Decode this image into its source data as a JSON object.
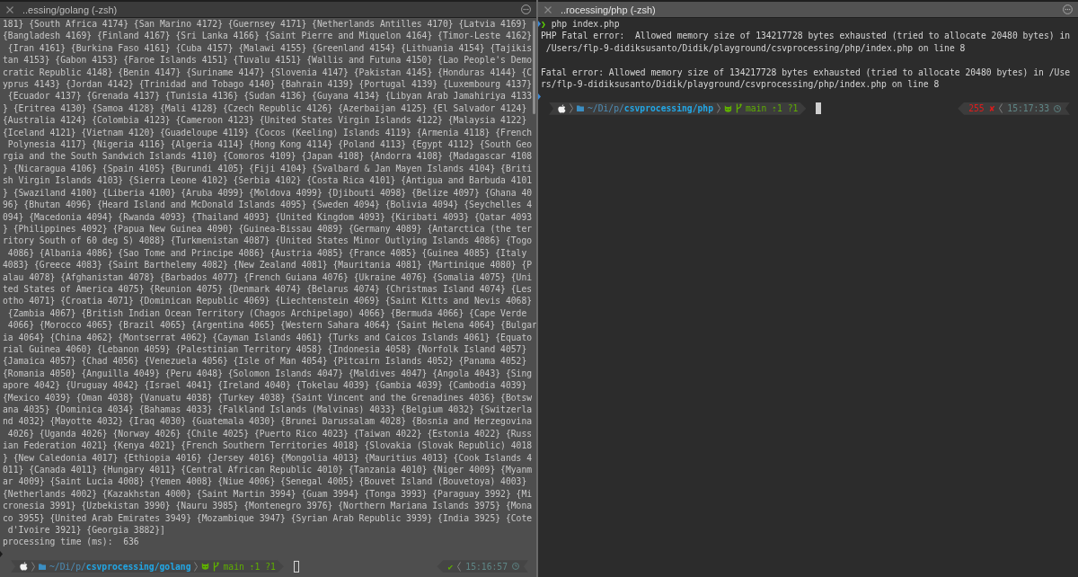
{
  "panes": [
    {
      "title": "..essing/golang (-zsh)",
      "active": false,
      "lines": [
        {
          "kind": "text",
          "text": "181} {South Africa 4174} {San Marino 4172} {Guernsey 4171} {Netherlands Antilles 4170} {Latvia 4169}"
        },
        {
          "kind": "text",
          "text": "{Bangladesh 4169} {Finland 4167} {Sri Lanka 4166} {Saint Pierre and Miquelon 4164} {Timor-Leste 4162}"
        },
        {
          "kind": "text",
          "text": " {Iran 4161} {Burkina Faso 4161} {Cuba 4157} {Malawi 4155} {Greenland 4154} {Lithuania 4154} {Tajikis"
        },
        {
          "kind": "text",
          "text": "tan 4153} {Gabon 4153} {Faroe Islands 4151} {Tuvalu 4151} {Wallis and Futuna 4150} {Lao People's Demo"
        },
        {
          "kind": "text",
          "text": "cratic Republic 4148} {Benin 4147} {Suriname 4147} {Slovenia 4147} {Pakistan 4145} {Honduras 4144} {C"
        },
        {
          "kind": "text",
          "text": "yprus 4143} {Jordan 4142} {Trinidad and Tobago 4140} {Bahrain 4139} {Portugal 4139} {Luxembourg 4137}"
        },
        {
          "kind": "text",
          "text": " {Ecuador 4137} {Grenada 4137} {Tunisia 4136} {Sudan 4136} {Guyana 4134} {Libyan Arab Jamahiriya 4133"
        },
        {
          "kind": "text",
          "text": "} {Eritrea 4130} {Samoa 4128} {Mali 4128} {Czech Republic 4126} {Azerbaijan 4125} {El Salvador 4124}"
        },
        {
          "kind": "text",
          "text": "{Australia 4124} {Colombia 4123} {Cameroon 4123} {United States Virgin Islands 4122} {Malaysia 4122}"
        },
        {
          "kind": "text",
          "text": "{Iceland 4121} {Vietnam 4120} {Guadeloupe 4119} {Cocos (Keeling) Islands 4119} {Armenia 4118} {French"
        },
        {
          "kind": "text",
          "text": " Polynesia 4117} {Nigeria 4116} {Algeria 4114} {Hong Kong 4114} {Poland 4113} {Egypt 4112} {South Geo"
        },
        {
          "kind": "text",
          "text": "rgia and the South Sandwich Islands 4110} {Comoros 4109} {Japan 4108} {Andorra 4108} {Madagascar 4108"
        },
        {
          "kind": "text",
          "text": "} {Nicaragua 4106} {Spain 4105} {Burundi 4105} {Fiji 4104} {Svalbard & Jan Mayen Islands 4104} {Briti"
        },
        {
          "kind": "text",
          "text": "sh Virgin Islands 4103} {Sierra Leone 4102} {Serbia 4102} {Costa Rica 4101} {Antigua and Barbuda 4101"
        },
        {
          "kind": "text",
          "text": "} {Swaziland 4100} {Liberia 4100} {Aruba 4099} {Moldova 4099} {Djibouti 4098} {Belize 4097} {Ghana 40"
        },
        {
          "kind": "text",
          "text": "96} {Bhutan 4096} {Heard Island and McDonald Islands 4095} {Sweden 4094} {Bolivia 4094} {Seychelles 4"
        },
        {
          "kind": "text",
          "text": "094} {Macedonia 4094} {Rwanda 4093} {Thailand 4093} {United Kingdom 4093} {Kiribati 4093} {Qatar 4093"
        },
        {
          "kind": "text",
          "text": "} {Philippines 4092} {Papua New Guinea 4090} {Guinea-Bissau 4089} {Germany 4089} {Antarctica (the ter"
        },
        {
          "kind": "text",
          "text": "ritory South of 60 deg S) 4088} {Turkmenistan 4087} {United States Minor Outlying Islands 4086} {Togo"
        },
        {
          "kind": "text",
          "text": " 4086} {Albania 4086} {Sao Tome and Principe 4086} {Austria 4085} {France 4085} {Guinea 4085} {Italy"
        },
        {
          "kind": "text",
          "text": "4083} {Greece 4083} {Saint Barthelemy 4082} {New Zealand 4081} {Mauritania 4081} {Martinique 4080} {P"
        },
        {
          "kind": "text",
          "text": "alau 4078} {Afghanistan 4078} {Barbados 4077} {French Guiana 4076} {Ukraine 4076} {Somalia 4075} {Uni"
        },
        {
          "kind": "text",
          "text": "ted States of America 4075} {Reunion 4075} {Denmark 4074} {Belarus 4074} {Christmas Island 4074} {Les"
        },
        {
          "kind": "text",
          "text": "otho 4071} {Croatia 4071} {Dominican Republic 4069} {Liechtenstein 4069} {Saint Kitts and Nevis 4068}"
        },
        {
          "kind": "text",
          "text": " {Zambia 4067} {British Indian Ocean Territory (Chagos Archipelago) 4066} {Bermuda 4066} {Cape Verde"
        },
        {
          "kind": "text",
          "text": " 4066} {Morocco 4065} {Brazil 4065} {Argentina 4065} {Western Sahara 4064} {Saint Helena 4064} {Bulgar"
        },
        {
          "kind": "text",
          "text": "ia 4064} {China 4062} {Montserrat 4062} {Cayman Islands 4061} {Turks and Caicos Islands 4061} {Equato"
        },
        {
          "kind": "text",
          "text": "rial Guinea 4060} {Lebanon 4059} {Palestinian Territory 4058} {Indonesia 4058} {Norfolk Island 4057}"
        },
        {
          "kind": "text",
          "text": "{Jamaica 4057} {Chad 4056} {Venezuela 4056} {Isle of Man 4054} {Pitcairn Islands 4052} {Panama 4052}"
        },
        {
          "kind": "text",
          "text": "{Romania 4050} {Anguilla 4049} {Peru 4048} {Solomon Islands 4047} {Maldives 4047} {Angola 4043} {Sing"
        },
        {
          "kind": "text",
          "text": "apore 4042} {Uruguay 4042} {Israel 4041} {Ireland 4040} {Tokelau 4039} {Gambia 4039} {Cambodia 4039}"
        },
        {
          "kind": "text",
          "text": "{Mexico 4039} {Oman 4038} {Vanuatu 4038} {Turkey 4038} {Saint Vincent and the Grenadines 4036} {Botsw"
        },
        {
          "kind": "text",
          "text": "ana 4035} {Dominica 4034} {Bahamas 4033} {Falkland Islands (Malvinas) 4033} {Belgium 4032} {Switzerla"
        },
        {
          "kind": "text",
          "text": "nd 4032} {Mayotte 4032} {Iraq 4030} {Guatemala 4030} {Brunei Darussalam 4028} {Bosnia and Herzegovina"
        },
        {
          "kind": "text",
          "text": " 4026} {Uganda 4026} {Norway 4026} {Chile 4025} {Puerto Rico 4023} {Taiwan 4022} {Estonia 4022} {Russ"
        },
        {
          "kind": "text",
          "text": "ian Federation 4021} {Kenya 4021} {French Southern Territories 4018} {Slovakia (Slovak Republic) 4018"
        },
        {
          "kind": "text",
          "text": "} {New Caledonia 4017} {Ethiopia 4016} {Jersey 4016} {Mongolia 4013} {Mauritius 4013} {Cook Islands 4"
        },
        {
          "kind": "text",
          "text": "011} {Canada 4011} {Hungary 4011} {Central African Republic 4010} {Tanzania 4010} {Niger 4009} {Myanm"
        },
        {
          "kind": "text",
          "text": "ar 4009} {Saint Lucia 4008} {Yemen 4008} {Niue 4006} {Senegal 4005} {Bouvet Island (Bouvetoya) 4003}"
        },
        {
          "kind": "text",
          "text": "{Netherlands 4002} {Kazakhstan 4000} {Saint Martin 3994} {Guam 3994} {Tonga 3993} {Paraguay 3992} {Mi"
        },
        {
          "kind": "text",
          "text": "cronesia 3991} {Uzbekistan 3990} {Nauru 3985} {Montenegro 3976} {Northern Mariana Islands 3975} {Mona"
        },
        {
          "kind": "text",
          "text": "co 3955} {United Arab Emirates 3949} {Mozambique 3947} {Syrian Arab Republic 3939} {India 3925} {Cote"
        },
        {
          "kind": "text",
          "text": " d'Ivoire 3921} {Georgia 3882}]"
        },
        {
          "kind": "text",
          "text": "processing time (ms):  636"
        },
        {
          "kind": "mark"
        }
      ],
      "prompt": {
        "path": "~/Di/p/**csvprocessing/golang**",
        "git_status": "main ⇡1 ?1",
        "exit_status": {
          "ok": true,
          "text": "✔"
        },
        "time": "15:16:57"
      }
    },
    {
      "title": "..rocessing/php (-zsh)",
      "active": true,
      "lines": [
        {
          "kind": "command",
          "prompt_symbol": "❯",
          "text": "php index.php"
        },
        {
          "kind": "text",
          "text": "PHP Fatal error:  Allowed memory size of 134217728 bytes exhausted (tried to allocate 20480 bytes) in"
        },
        {
          "kind": "text",
          "text": " /Users/flp-9-didiksusanto/Didik/playground/csvprocessing/php/index.php on line 8"
        },
        {
          "kind": "blank"
        },
        {
          "kind": "text",
          "text": "Fatal error: Allowed memory size of 134217728 bytes exhausted (tried to allocate 20480 bytes) in /Use"
        },
        {
          "kind": "text",
          "text": "rs/flp-9-didiksusanto/Didik/playground/csvprocessing/php/index.php on line 8"
        },
        {
          "kind": "mark"
        }
      ],
      "prompt": {
        "path": "~/Di/p/**csvprocessing/php**",
        "git_status": "main ⇡1 ?1",
        "exit_status": {
          "ok": false,
          "text": "255 ✘"
        },
        "time": "15:17:33"
      }
    }
  ]
}
